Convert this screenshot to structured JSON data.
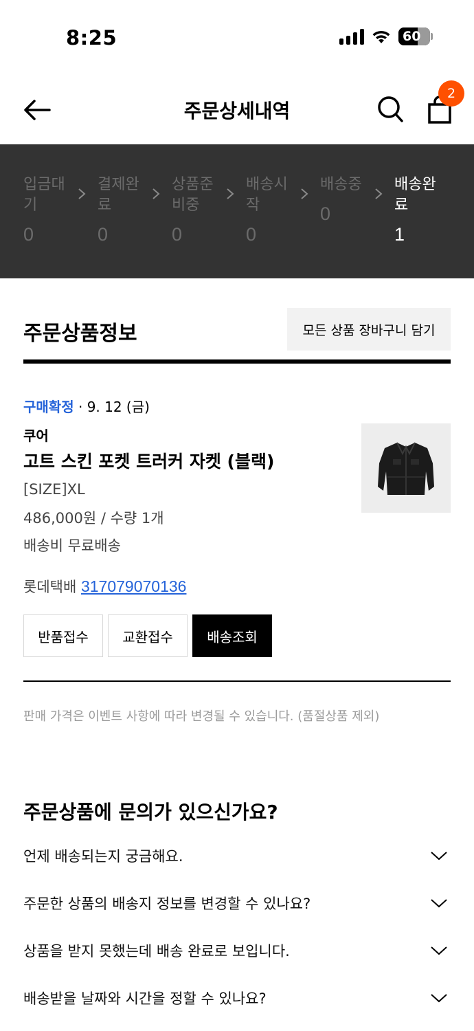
{
  "status_bar": {
    "time": "8:25",
    "battery": "60"
  },
  "header": {
    "title": "주문상세내역",
    "cart_badge": "2"
  },
  "progress": {
    "steps": [
      {
        "label": "입금대기",
        "count": "0"
      },
      {
        "label": "결제완료",
        "count": "0"
      },
      {
        "label": "상품준비중",
        "count": "0"
      },
      {
        "label": "배송시작",
        "count": "0"
      },
      {
        "label": "배송중",
        "count": "0"
      },
      {
        "label": "배송완료",
        "count": "1"
      }
    ],
    "active_index": 5
  },
  "order": {
    "section_title": "주문상품정보",
    "cart_all_label": "모든 상품 장바구니 담기",
    "status": "구매확정",
    "separator": " · ",
    "date": "9. 12 (금)",
    "brand": "쿠어",
    "product_name": "고트 스킨 포켓 트러커 자켓 (블랙)",
    "option": "[SIZE]XL",
    "price_qty": "486,000원 / 수량 1개",
    "shipping_fee": "배송비 무료배송",
    "courier": "롯데택배",
    "tracking_number": "317079070136",
    "buttons": {
      "return": "반품접수",
      "exchange": "교환접수",
      "tracking": "배송조회"
    },
    "notice": "판매 가격은 이벤트 사항에 따라 변경될 수 있습니다. (품절상품 제외)"
  },
  "faq": {
    "title": "주문상품에 문의가 있으신가요?",
    "items": [
      "언제 배송되는지 궁금해요.",
      "주문한 상품의 배송지 정보를 변경할 수 있나요?",
      "상품을 받지 못했는데 배송 완료로 보입니다.",
      "배송받을 날짜와 시간을 정할 수 있나요?"
    ]
  },
  "colors": {
    "accent_blue": "#2563d9",
    "badge_orange": "#ff5000",
    "progress_bg": "#333333"
  },
  "icons": [
    "back-arrow-icon",
    "search-icon",
    "shopping-bag-icon",
    "chevron-right-icon",
    "chevron-down-icon",
    "signal-icon",
    "wifi-icon",
    "battery-icon"
  ]
}
